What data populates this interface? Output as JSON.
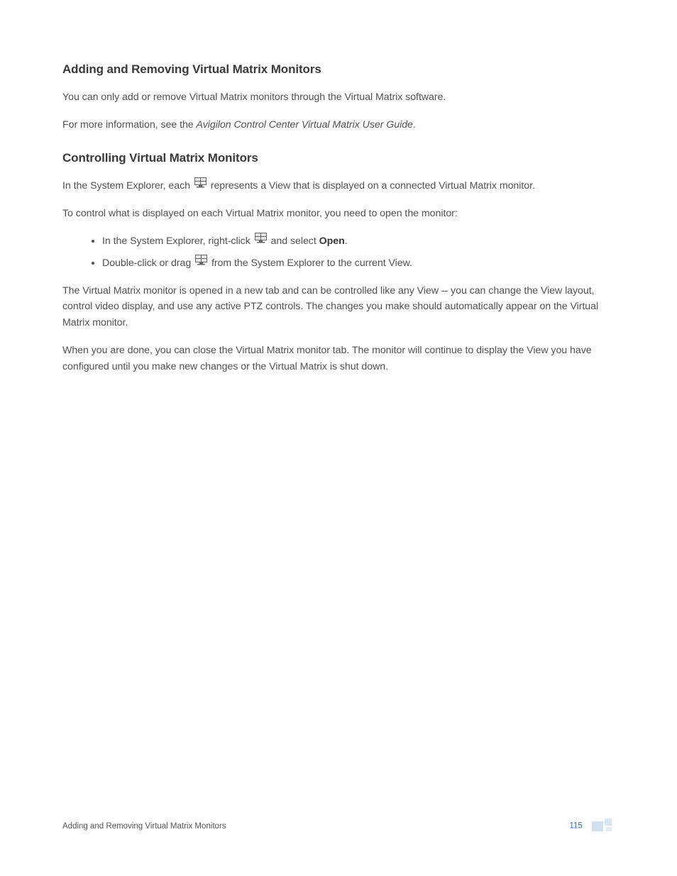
{
  "heading1": "Adding and Removing Virtual Matrix Monitors",
  "p1": "You can only add or remove Virtual Matrix monitors through the Virtual Matrix software.",
  "p2_pre": "For more information, see the ",
  "p2_em": "Avigilon Control Center Virtual Matrix User Guide",
  "p2_post": ".",
  "heading2": "Controlling Virtual Matrix Monitors",
  "p3_a": "In the System Explorer, each ",
  "p3_b": " represents a View that is displayed on a connected Virtual Matrix monitor.",
  "p4": "To control what is displayed on each Virtual Matrix monitor, you need to open the monitor:",
  "li1_a": "In the System Explorer, right-click ",
  "li1_b": " and select ",
  "li1_strong": "Open",
  "li1_c": ".",
  "li2_a": "Double-click or drag ",
  "li2_b": " from the System Explorer to the current View.",
  "p5": "The Virtual Matrix monitor is opened in a new tab and can be controlled like any View -- you can change the View layout, control video display, and use any active PTZ controls. The changes you make should automatically appear on the Virtual Matrix monitor.",
  "p6": "When you are done, you can close the Virtual Matrix monitor tab. The monitor will continue to display the View you have configured until you make new changes or the Virtual Matrix is shut down.",
  "footer_title": "Adding and Removing Virtual Matrix Monitors",
  "page_number": "115"
}
